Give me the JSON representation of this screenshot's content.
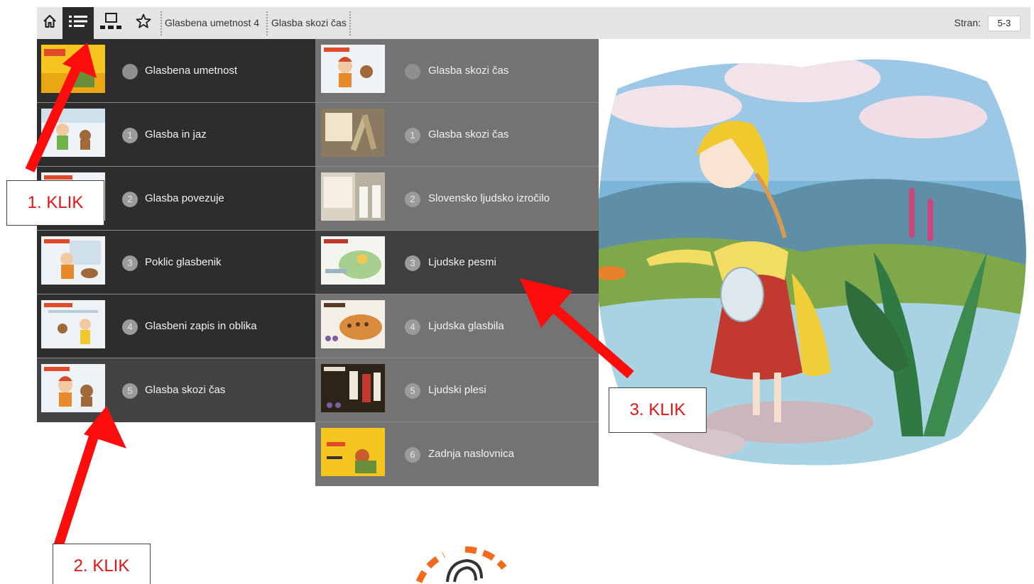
{
  "toolbar": {
    "home_icon": "home-icon",
    "toc_icon": "list-icon",
    "pages_icon": "page-thumbnails-icon",
    "bookmark_icon": "star-icon",
    "breadcrumbs": [
      "Glasbena umetnost 4",
      "Glasba skozi čas"
    ],
    "page_label": "Stran:",
    "page_value": "5-3"
  },
  "menu_left": {
    "items": [
      {
        "num": "",
        "title": "Glasbena umetnost"
      },
      {
        "num": "1",
        "title": "Glasba in jaz"
      },
      {
        "num": "2",
        "title": "Glasba povezuje"
      },
      {
        "num": "3",
        "title": "Poklic glasbenik"
      },
      {
        "num": "4",
        "title": "Glasbeni zapis in oblika"
      },
      {
        "num": "5",
        "title": "Glasba skozi čas"
      }
    ]
  },
  "menu_right": {
    "items": [
      {
        "num": "",
        "title": "Glasba skozi čas"
      },
      {
        "num": "1",
        "title": "Glasba skozi čas"
      },
      {
        "num": "2",
        "title": "Slovensko ljudsko izročilo"
      },
      {
        "num": "3",
        "title": "Ljudske pesmi"
      },
      {
        "num": "4",
        "title": "Ljudska glasbila"
      },
      {
        "num": "5",
        "title": "Ljudski plesi"
      },
      {
        "num": "6",
        "title": "Zadnja naslovnica"
      }
    ]
  },
  "callouts": {
    "step1": "1. KLIK",
    "step2": "2. KLIK",
    "step3": "3. KLIK"
  },
  "colors": {
    "annotation": "#e01515",
    "toolbar_bg": "#e4e4e4",
    "menu_left_bg": "#2d2d2d",
    "menu_right_bg": "#737373"
  }
}
